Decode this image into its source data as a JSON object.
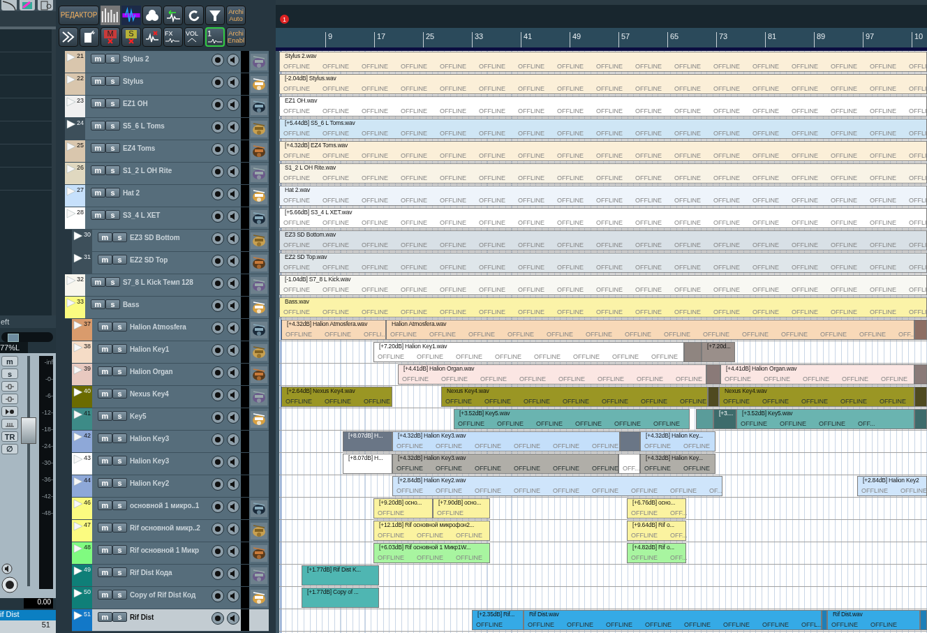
{
  "sidebar": {
    "top_icons": [
      {
        "kind": "icon"
      },
      {
        "kind": "icon"
      },
      {
        "kind": "icon"
      }
    ],
    "channel_label": "eft",
    "pan": {
      "level": 0.15,
      "reading": "77%L"
    },
    "buttons": [
      {
        "kind": "text",
        "label": "m"
      },
      {
        "kind": "text",
        "label": "s"
      },
      {
        "kind": "icon"
      },
      {
        "kind": "icon"
      },
      {
        "kind": "icon"
      },
      {
        "kind": "icon"
      },
      {
        "kind": "text",
        "label": "TR"
      },
      {
        "kind": "text",
        "label": "∅"
      }
    ],
    "fader": {
      "level": 0.7
    },
    "scale": [
      "-inf",
      "-0-",
      "-6-",
      "-12-",
      "-18-",
      "-24-",
      "-30-",
      "-36-",
      "-42-",
      "-48-"
    ],
    "volume": "0.00",
    "channel_name": "if Dist",
    "channel_number": "51"
  },
  "toolbar": {
    "upper_buttons": [
      {
        "kind": "text",
        "label": "РЕДАКТОР"
      },
      {
        "kind": "thumb"
      },
      {
        "kind": "thumb"
      },
      {
        "kind": "icon"
      },
      {
        "kind": "icon"
      },
      {
        "kind": "icon"
      },
      {
        "kind": "icon"
      },
      {
        "kind": "small",
        "label": "Archi Auto"
      }
    ],
    "lower_buttons": [
      {
        "kind": "icon"
      },
      {
        "kind": "icon"
      },
      {
        "kind": "letter",
        "label": "M"
      },
      {
        "kind": "letter",
        "label": "S"
      },
      {
        "kind": "icon"
      },
      {
        "kind": "letter",
        "label": "FX"
      },
      {
        "kind": "letter",
        "label": "VOL"
      },
      {
        "kind": "letter",
        "label": "1"
      },
      {
        "kind": "small",
        "label": "Archi Enabl"
      }
    ]
  },
  "marker": "1",
  "ruler": [
    "9",
    "17",
    "25",
    "33",
    "41",
    "49",
    "57",
    "65",
    "73",
    "81",
    "89",
    "97",
    "10"
  ],
  "tracks": [
    {
      "number": "21",
      "name": "Stylus 2",
      "mute": "m",
      "solo": "s",
      "color": "#d9c6ad",
      "selected": false,
      "thumbnail": {
        "kind": "picture"
      },
      "clips": [
        {
          "label": "Stylus 2.wav",
          "color": "#fbefd8",
          "offline": [
            "OFFLINE",
            "OFFLINE",
            "OFFLINE",
            "OFFLINE",
            "OFFLINE",
            "OFFLINE",
            "OFFLINE",
            "OFFLINE",
            "OFFLINE",
            "OFFLINE",
            "OFFLINE",
            "OFFLINE",
            "OFFLINE",
            "OFFLINE",
            "OFFLINE",
            "OFFLINE",
            "OFFLI"
          ]
        }
      ]
    },
    {
      "number": "22",
      "name": "Stylus",
      "mute": "m",
      "solo": "s",
      "color": "#d9c6ad",
      "selected": false,
      "thumbnail": {
        "kind": "picture"
      },
      "clips": [
        {
          "label": "[-2.04dB] Stylus.wav",
          "color": "#fbefd8",
          "offline": [
            "OFFLINE",
            "OFFLINE",
            "OFFLINE",
            "OFFLINE",
            "OFFLINE",
            "OFFLINE",
            "OFFLINE",
            "OFFLINE",
            "OFFLINE",
            "OFFLINE",
            "OFFLINE",
            "OFFLINE",
            "OFFLINE",
            "OFFLINE",
            "OFFLINE",
            "OFFLINE",
            "OFFLI"
          ]
        }
      ]
    },
    {
      "number": "23",
      "name": "EZ1 OH",
      "mute": "m",
      "solo": "s",
      "color": "#f0f0f0",
      "selected": false,
      "thumbnail": {
        "kind": "picture"
      },
      "clips": [
        {
          "label": "EZ1 OH.wav",
          "color": "#ffffff",
          "offline": [
            "OFFLINE",
            "OFFLINE",
            "OFFLINE",
            "OFFLINE",
            "OFFLINE",
            "OFFLINE",
            "OFFLINE",
            "OFFLINE",
            "OFFLINE",
            "OFFLINE",
            "OFFLINE",
            "OFFLINE",
            "OFFLINE",
            "OFFLINE",
            "OFFLINE",
            "OFFLINE",
            "OFFLI"
          ]
        }
      ]
    },
    {
      "number": "24",
      "name": "S5_6 L Toms",
      "mute": "m",
      "solo": "s",
      "color": "#3d4f5a",
      "selected": false,
      "thumbnail": {
        "kind": "picture"
      },
      "clips": [
        {
          "label": "[+5.44dB] S5_6 L Toms.wav",
          "color": "#cfe6f5",
          "offline": [
            "OFFLINE",
            "OFFLINE",
            "OFFLINE",
            "OFFLINE",
            "OFFLINE",
            "OFFLINE",
            "OFFLINE",
            "OFFLINE",
            "OFFLINE",
            "OFFLINE",
            "OFFLINE",
            "OFFLINE",
            "OFFLINE",
            "OFFLINE",
            "OFFLINE",
            "OFFLINE",
            "OFFLI"
          ]
        }
      ]
    },
    {
      "number": "25",
      "name": "EZ4 Toms",
      "mute": "m",
      "solo": "s",
      "color": "#d9c6ad",
      "selected": false,
      "thumbnail": {
        "kind": "picture"
      },
      "clips": [
        {
          "label": "[+4.32dB] EZ4 Toms.wav",
          "color": "#fbefd8",
          "offline": [
            "OFFLINE",
            "OFFLINE",
            "OFFLINE",
            "OFFLINE",
            "OFFLINE",
            "OFFLINE",
            "OFFLINE",
            "OFFLINE",
            "OFFLINE",
            "OFFLINE",
            "OFFLINE",
            "OFFLINE",
            "OFFLINE",
            "OFFLINE",
            "OFFLINE",
            "OFFLINE",
            "OFFLI"
          ]
        }
      ]
    },
    {
      "number": "26",
      "name": "S1_2 L OH Rite",
      "mute": "m",
      "solo": "s",
      "color": "#e0d8c0",
      "selected": false,
      "thumbnail": {
        "kind": "picture"
      },
      "clips": [
        {
          "label": "S1_2 L OH Rite.wav",
          "color": "#f8f3e6",
          "offline": [
            "OFFLINE",
            "OFFLINE",
            "OFFLINE",
            "OFFLINE",
            "OFFLINE",
            "OFFLINE",
            "OFFLINE",
            "OFFLINE",
            "OFFLINE",
            "OFFLINE",
            "OFFLINE",
            "OFFLINE",
            "OFFLINE",
            "OFFLINE",
            "OFFLINE",
            "OFFLINE",
            "OFFLI"
          ]
        }
      ]
    },
    {
      "number": "27",
      "name": "Hat 2",
      "mute": "m",
      "solo": "s",
      "color": "#c6e0fb",
      "selected": false,
      "thumbnail": {
        "kind": "picture"
      },
      "clips": [
        {
          "label": "Hat 2.wav",
          "color": "#eef4fb",
          "offline": [
            "OFFLINE",
            "OFFLINE",
            "OFFLINE",
            "OFFLINE",
            "OFFLINE",
            "OFFLINE",
            "OFFLINE",
            "OFFLINE",
            "OFFLINE",
            "OFFLINE",
            "OFFLINE",
            "OFFLINE",
            "OFFLINE",
            "OFFLINE",
            "OFFLINE",
            "OFFLINE",
            "OFFLI"
          ]
        }
      ]
    },
    {
      "number": "28",
      "name": "S3_4 L XET",
      "mute": "m",
      "solo": "s",
      "color": "#ffffff",
      "selected": false,
      "thumbnail": {
        "kind": "picture"
      },
      "clips": [
        {
          "label": "[+5.66dB] S3_4 L XET.wav",
          "color": "#ffffff",
          "offline": [
            "OFFLINE",
            "OFFLINE",
            "OFFLINE",
            "OFFLINE",
            "OFFLINE",
            "OFFLINE",
            "OFFLINE",
            "OFFLINE",
            "OFFLINE",
            "OFFLINE",
            "OFFLINE",
            "OFFLINE",
            "OFFLINE",
            "OFFLINE",
            "OFFLINE",
            "OFFLINE",
            "OFFLI"
          ]
        }
      ],
      "children": [
        {
          "number": "30",
          "name": "EZ3 SD Bottom",
          "mute": "m",
          "solo": "s",
          "color": "#3d4f5a",
          "selected": false,
          "thumbnail": {
            "kind": "picture"
          },
          "clips": [
            {
              "label": "EZ3 SD Bottom.wav",
              "color": "#d8e0e6",
              "offline": [
                "OFFLINE",
                "OFFLINE",
                "OFFLINE",
                "OFFLINE",
                "OFFLINE",
                "OFFLINE",
                "OFFLINE",
                "OFFLINE",
                "OFFLINE",
                "OFFLINE",
                "OFFLINE",
                "OFFLINE",
                "OFFLINE",
                "OFFLINE",
                "OFFLINE",
                "OFFLINE",
                "OFFLI"
              ]
            }
          ]
        },
        {
          "number": "31",
          "name": "EZ2 SD Top",
          "mute": "m",
          "solo": "s",
          "color": "#3d4f5a",
          "selected": false,
          "thumbnail": {
            "kind": "picture"
          },
          "clips": [
            {
              "label": "EZ2 SD Top.wav",
              "color": "#dfe6ea",
              "offline": [
                "OFFLINE",
                "OFFLINE",
                "OFFLINE",
                "OFFLINE",
                "OFFLINE",
                "OFFLINE",
                "OFFLINE",
                "OFFLINE",
                "OFFLINE",
                "OFFLINE",
                "OFFLINE",
                "OFFLINE",
                "OFFLINE",
                "OFFLINE",
                "OFFLINE",
                "OFFLINE",
                "OFFLI"
              ]
            }
          ]
        }
      ]
    },
    {
      "number": "32",
      "name": "S7_8 L Kick Темп 128",
      "mute": "m",
      "solo": "s",
      "color": "#f8f6ee",
      "selected": false,
      "thumbnail": {
        "kind": "picture"
      },
      "clips": [
        {
          "label": "[-1.04dB] S7_8 L Kick.wav",
          "color": "#f8f8f3",
          "offline": [
            "OFFLINE",
            "OFFLINE",
            "OFFLINE",
            "OFFLINE",
            "OFFLINE",
            "OFFLINE",
            "OFFLINE",
            "OFFLINE",
            "OFFLINE",
            "OFFLINE",
            "OFFLINE",
            "OFFLINE",
            "OFFLINE",
            "OFFLINE",
            "OFFLINE",
            "OFFLINE",
            "OFFLI"
          ]
        }
      ]
    },
    {
      "number": "33",
      "name": "Bass",
      "mute": "m",
      "solo": "s",
      "color": "#fbfb80",
      "selected": false,
      "thumbnail": {
        "kind": "picture"
      },
      "clips": [
        {
          "label": "Bass.wav",
          "color": "#fbf3a8",
          "offline": [
            "OFFLINE",
            "OFFLINE",
            "OFFLINE",
            "OFFLINE",
            "OFFLINE",
            "OFFLINE",
            "OFFLINE",
            "OFFLINE",
            "OFFLINE",
            "OFFLINE",
            "OFFLINE",
            "OFFLINE",
            "OFFLINE",
            "OFFLINE",
            "OFFLINE",
            "OFFLINE",
            "OFFLI"
          ]
        }
      ],
      "children": [
        {
          "number": "37",
          "name": "Halion Atmosfera",
          "mute": "m",
          "solo": "s",
          "color": "#d99b6c",
          "selected": false,
          "thumbnail": {
            "kind": "picture"
          },
          "clips": [
            {
              "label": "[+4.32dB] Halion Atmosfera.wav",
              "color": "#f8d9b8",
              "offline": [
                "OFFLINE",
                "OFFLINE",
                "OFFLI..."
              ]
            },
            {
              "label": "Halion Atmosfera.wav",
              "color": "#f8d9b8",
              "offline": [
                "OFFLINE",
                "OFFLINE",
                "OFFLINE",
                "OFFLINE",
                "OFFLINE",
                "OFFLINE",
                "OFFLINE",
                "OFFLINE",
                "OFFLINE",
                "OFFLINE",
                "OFFLINE",
                "OFFLINE",
                "OFFLINE",
                "OFF..."
              ]
            },
            {
              "color": "#8d6e63"
            }
          ]
        },
        {
          "number": "38",
          "name": "Halion Key1",
          "mute": "m",
          "solo": "s",
          "color": "#f5dcc6",
          "selected": false,
          "thumbnail": {
            "kind": "picture"
          },
          "clips": [
            {
              "label": "[+7.20dB] Halion Key1.wav",
              "color": "#ffffff",
              "offline": [
                "OFFLINE",
                "OFFLINE",
                "OFFLINE",
                "OFFLINE",
                "OFFLINE",
                "OFFLINE",
                "OFFLINE",
                "OFFLINE"
              ]
            },
            {
              "color": "#8f8580"
            },
            {
              "label": "[+7.20d...",
              "color": "#9a8f8a"
            }
          ]
        },
        {
          "number": "39",
          "name": "Halion Organ",
          "mute": "m",
          "solo": "s",
          "color": "#e8c9c0",
          "selected": false,
          "thumbnail": {
            "kind": "picture"
          },
          "clips": [
            {
              "label": "[+4.41dB] Halion Organ.wav",
              "color": "#fbe6e3",
              "offline": [
                "OFFLINE",
                "OFFLINE",
                "OFFLINE",
                "OFFLINE",
                "OFFLINE",
                "OFFLINE",
                "OFFLINE",
                "OFFLINE"
              ]
            },
            {
              "color": "#8a7a78"
            },
            {
              "label": "[+4.41dB] Halion Organ.wav",
              "color": "#fbe6e3",
              "offline": [
                "OFFLINE",
                "OFFLINE",
                "OFFLINE",
                "OFFLINE",
                "OFFLINE"
              ]
            },
            {
              "color": "#8a7a78"
            }
          ]
        },
        {
          "number": "40",
          "name": "Nexus Key4",
          "mute": "m",
          "solo": "s",
          "color": "#6b6b00",
          "selected": false,
          "thumbnail": {
            "kind": "picture"
          },
          "clips": [
            {
              "label": "[+2.64dB] Nexus Key4.wav",
              "color": "#9a9624",
              "offline": [
                "OFFLINE",
                "OFFLINE",
                "OFFLINE"
              ]
            },
            {
              "label": "Nexus Key4.wav",
              "color": "#9a9624",
              "offline": [
                "OFFLINE",
                "OFFLINE",
                "OFFLINE",
                "OFFLINE",
                "OFFLINE",
                "OFFLINE",
                "OFFLINE"
              ]
            },
            {
              "color": "#4f4a20"
            },
            {
              "label": "Nexus Key4.wav",
              "color": "#9a9624",
              "offline": [
                "OFFLINE",
                "OFFLINE",
                "OFFLINE",
                "OFFLINE",
                "OFFLINE"
              ]
            },
            {
              "color": "#4f4a20"
            }
          ]
        },
        {
          "number": "41",
          "name": "Key5",
          "mute": "m",
          "solo": "s",
          "color": "#3d8b87",
          "selected": false,
          "thumbnail": {
            "kind": "picture"
          },
          "clips": [
            {
              "label": "[+3.52dB] Key5.wav",
              "color": "#6ab4b0",
              "offline": [
                "OFFLINE",
                "OFFLINE",
                "OFFLINE",
                "OFFLINE",
                "OFFLINE",
                "OFFLINE"
              ]
            },
            {
              "color": "#5a9c9a"
            },
            {
              "label": "[+3....",
              "color": "#3d6b6b"
            },
            {
              "label": "[+3.52dB] Key5.wav",
              "color": "#6ab4b0",
              "offline": [
                "OFFLINE",
                "OFFLINE",
                "OFFLINE",
                "OFF..."
              ]
            },
            {
              "color": "#3d6b6b"
            }
          ]
        },
        {
          "number": "42",
          "name": "Halion Key3",
          "mute": "m",
          "solo": "s",
          "color": "#8ea8d8",
          "selected": false,
          "clips": [
            {
              "label": "[+8.07dB] H...",
              "color": "#6a7686"
            },
            {
              "label": "[+4.32dB] Halion Key3.wav",
              "color": "#c4dffa",
              "offline": [
                "OFFLINE",
                "OFFLINE",
                "OFFLINE",
                "OFFLINE",
                "OFFLINE",
                "OFFLINE"
              ]
            },
            {
              "color": "#6a7686"
            },
            {
              "label": "[+4.32dB] Halion Key...",
              "color": "#c4dffa",
              "offline": [
                "OFFLINE",
                "OFFLINE"
              ]
            }
          ]
        },
        {
          "number": "43",
          "name": "Halion Key3",
          "mute": "m",
          "solo": "s",
          "color": "#ffffff",
          "selected": false,
          "clips": [
            {
              "label": "[+8.07dB] H...",
              "color": "#ffffff"
            },
            {
              "label": "[+4.32dB] Halion Key3.wav",
              "color": "#b0aea8",
              "offline": [
                "OFFLINE",
                "OFFLINE",
                "OFFLINE",
                "OFFLINE",
                "OFFLINE",
                "OFFLINE"
              ]
            },
            {
              "color": "#ffffff",
              "offline": [
                "OFF..."
              ]
            },
            {
              "label": "[+4.32dB] Halion Key...",
              "color": "#b0aea8",
              "offline": [
                "OFFLINE",
                "OFFLINE"
              ]
            }
          ]
        },
        {
          "number": "44",
          "name": "Halion Key2",
          "mute": "m",
          "solo": "s",
          "color": "#8ea8d8",
          "selected": false,
          "clips": [
            {
              "label": "[+2.84dB] Halion Key2.wav",
              "color": "#cfe5fb",
              "offline": [
                "OFFLINE",
                "OFFLINE",
                "OFFLINE",
                "OFFLINE",
                "OFFLINE",
                "OFFLINE",
                "OFFLINE",
                "OFFLINE",
                "OF..."
              ]
            },
            {
              "label": "[+2.84dB] Halion Key2",
              "color": "#cfe5fb",
              "offline": [
                "OFFLINE",
                "OFFLINE"
              ]
            }
          ]
        },
        {
          "number": "46",
          "name": "основной 1 микро..1",
          "mute": "m",
          "solo": "s",
          "color": "#fbfb80",
          "selected": false,
          "thumbnail": {
            "kind": "picture"
          },
          "clips": [
            {
              "label": "[+9.20dB] осно...",
              "color": "#fbf3a0",
              "offline": [
                "OFFLINE"
              ]
            },
            {
              "label": "[+7.90dB] осно...",
              "color": "#fbf3a0",
              "offline": [
                "OFFLINE"
              ]
            },
            {
              "label": "[+6.76dB] осно...",
              "color": "#fbf3a0",
              "offline": [
                "OFFLINE",
                "OFF..."
              ]
            }
          ]
        },
        {
          "number": "47",
          "name": "Rif основной микр..2",
          "mute": "m",
          "solo": "s",
          "color": "#fbfb80",
          "selected": false,
          "thumbnail": {
            "kind": "picture"
          },
          "clips": [
            {
              "label": "[+12.1dB] Rif основной микрофон2...",
              "color": "#fbf3a0",
              "offline": [
                "OFFLINE",
                "OFFLINE",
                "OFFLINE"
              ]
            },
            {
              "label": "[+9.64dB] Rif о...",
              "color": "#fbf3a0",
              "offline": [
                "OFFLINE",
                "OFF..."
              ]
            }
          ]
        },
        {
          "number": "48",
          "name": "Rif основной 1 Микр",
          "mute": "m",
          "solo": "s",
          "color": "#80fb80",
          "selected": false,
          "thumbnail": {
            "kind": "picture"
          },
          "clips": [
            {
              "label": "[+6.03dB] Rif основной 1 Микр1W...",
              "color": "#a8f5a0",
              "offline": [
                "OFFLINE",
                "OFFLINE",
                "OFFLINE"
              ]
            },
            {
              "label": "[+4.82dB] Rif о...",
              "color": "#a8f5a0",
              "offline": [
                "OFFLINE",
                "OFF..."
              ]
            }
          ]
        },
        {
          "number": "49",
          "name": "Rif Dist Кода",
          "mute": "m",
          "solo": "s",
          "color": "#0f7f78",
          "selected": false,
          "thumbnail": {
            "kind": "picture"
          },
          "clips": [
            {
              "label": "[+1.77dB] Rif Dist K...",
              "color": "#4fb6b2"
            }
          ]
        },
        {
          "number": "50",
          "name": "Copy of   Rif Dist Код",
          "mute": "m",
          "solo": "s",
          "color": "#0f7f78",
          "selected": false,
          "thumbnail": {
            "kind": "picture"
          },
          "clips": [
            {
              "label": "[+1.77dB] Copy of ...",
              "color": "#4fb6b2"
            }
          ]
        },
        {
          "number": "51",
          "name": "Rif Dist",
          "mute": "m",
          "solo": "s",
          "color": "#1278c8",
          "selected": true,
          "clips": [
            {
              "label": "[+2.35dB] Rif...",
              "color": "#35aae6",
              "offline": [
                "OFFLINE"
              ]
            },
            {
              "label": "Rif Dist.wav",
              "color": "#35aae6",
              "offline": [
                "OFFLINE",
                "OFFLINE",
                "OFFLINE",
                "OFFLINE",
                "OFFLINE",
                "OFFLINE",
                "OFFLINE",
                "OFFL..."
              ]
            },
            {
              "color": "#1e7fb8"
            },
            {
              "label": "Rif Dist.wav",
              "color": "#35aae6",
              "offline": [
                "OFFLINE",
                "OFFLINE"
              ]
            },
            {
              "color": "#1e7fb8"
            }
          ]
        }
      ]
    }
  ]
}
